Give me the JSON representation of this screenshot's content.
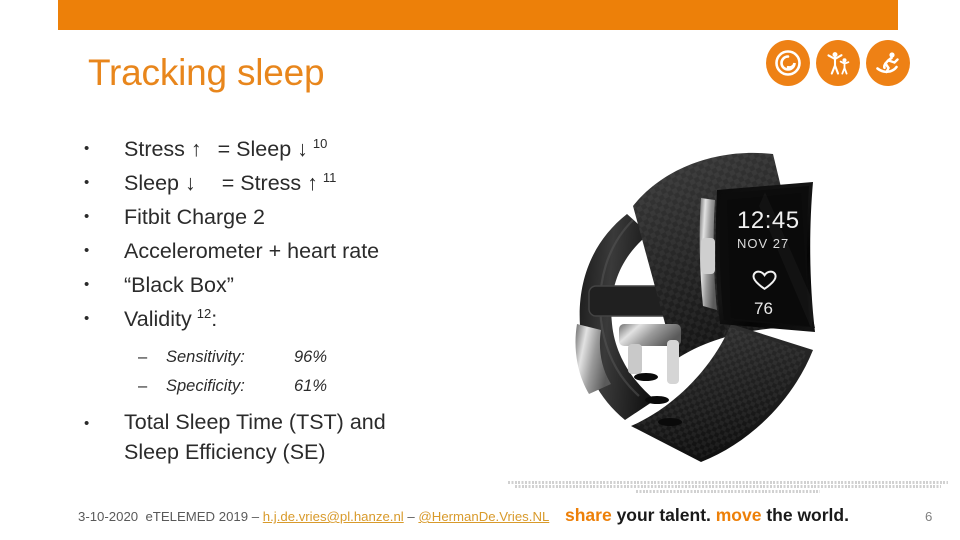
{
  "theme": {
    "accent_orange": "#ED8009",
    "title_orange": "#E8861C",
    "link_gold": "#D89A2B",
    "body_text": "#2b2b2b"
  },
  "header": {
    "bar_color": "#ED8009",
    "title": "Tracking sleep",
    "logos": [
      {
        "name": "swirl-logo-icon",
        "alt": "swirl circle mark"
      },
      {
        "name": "two-figures-logo-icon",
        "alt": "adult and child figures mark"
      },
      {
        "name": "running-figure-logo-icon",
        "alt": "running figure mark"
      }
    ]
  },
  "content": {
    "bullet_mark": "•",
    "sub_bullet_mark": "–",
    "bullets": [
      {
        "id": "stress-up-sleep-down",
        "pre": "Stress ↑",
        "post": "= Sleep ↓",
        "sup": "10"
      },
      {
        "id": "sleep-down-stress-up",
        "pre": "Sleep ↓",
        "post": "= Stress ↑",
        "sup": "11"
      },
      {
        "id": "fitbit-charge-2",
        "text": "Fitbit Charge 2"
      },
      {
        "id": "accelerometer-heart-rate",
        "text": "Accelerometer + heart rate"
      },
      {
        "id": "black-box",
        "text": "“Black Box”"
      },
      {
        "id": "validity",
        "pre": "Validity",
        "sup": "12",
        "post_colon": ":"
      }
    ],
    "sub_bullets": [
      {
        "id": "sensitivity",
        "label": "Sensitivity:",
        "value": "96%"
      },
      {
        "id": "specificity",
        "label": "Specificity:",
        "value": "61%"
      }
    ],
    "final_bullet": {
      "id": "tst-se",
      "line1": "Total Sleep Time (TST) and",
      "line2": "Sleep Efficiency (SE)"
    }
  },
  "device": {
    "name": "Fitbit Charge 2",
    "screen": {
      "time": "12:45",
      "date": "NOV 27",
      "heart_icon": "heart-icon",
      "heart_rate": "76"
    }
  },
  "attribution": {
    "note": "illegible micro-text attribution block"
  },
  "footer": {
    "date": "3-10-2020",
    "event": "eTELEMED 2019",
    "separator": "–",
    "email": "h.j.de.vries@pl.hanze.nl",
    "handle": "@HermanDe.Vries.NL",
    "tagline_part1": "share",
    "tagline_part2": " your talent. ",
    "tagline_part3": "move",
    "tagline_part4": " the world.",
    "page_number": "6"
  }
}
